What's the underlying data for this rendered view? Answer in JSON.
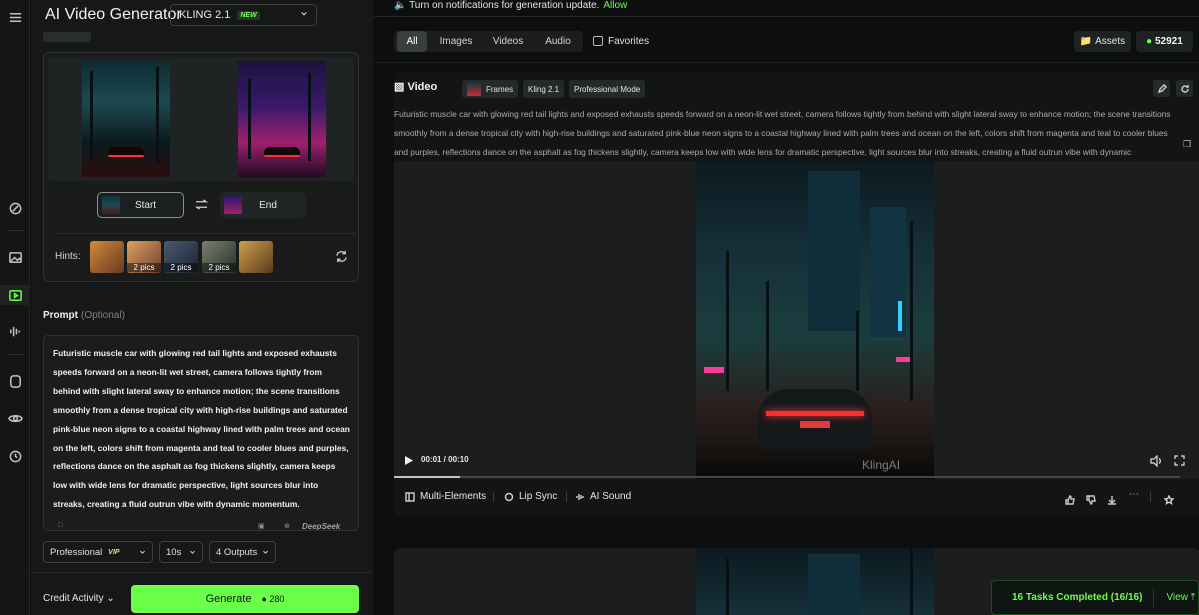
{
  "app": {
    "title": "AI Video Generator",
    "model": "KLING 2.1",
    "model_badge": "NEW"
  },
  "frames": {
    "start_label": "Start",
    "end_label": "End"
  },
  "hints": {
    "label": "Hints:",
    "items": [
      {
        "count": ""
      },
      {
        "count": "2 pics"
      },
      {
        "count": "2 pics"
      },
      {
        "count": "2 pics"
      },
      {
        "count": ""
      }
    ]
  },
  "prompt": {
    "label": "Prompt",
    "optional": "(Optional)",
    "text": "Futuristic muscle car with glowing red tail lights and exposed exhausts speeds forward on a neon-lit wet street, camera follows tightly from behind with slight lateral sway to enhance motion; the scene transitions smoothly from a dense tropical city with high-rise buildings and saturated pink-blue neon signs to a coastal highway lined with palm trees and ocean on the left, colors shift from magenta and teal to cooler blues and purples, reflections dance on the asphalt as fog thickens slightly, camera keeps low with wide lens for dramatic perspective, light sources blur into streaks, creating a fluid outrun vibe with dynamic momentum.",
    "assistant": "DeepSeek"
  },
  "settings": {
    "mode": "Professional",
    "mode_badge": "VIP",
    "duration": "10s",
    "outputs": "4 Outputs"
  },
  "footer": {
    "credit_activity": "Credit Activity",
    "generate": "Generate",
    "generate_cost": "280"
  },
  "notice": {
    "text": "Turn on notifications for generation update.",
    "allow": "Allow"
  },
  "filters": {
    "tabs": [
      "All",
      "Images",
      "Videos",
      "Audio"
    ],
    "active": "All",
    "favorites": "Favorites"
  },
  "account": {
    "assets": "Assets",
    "credits": "52921"
  },
  "result": {
    "heading": "Video",
    "chips": [
      "Frames",
      "Kling 2.1",
      "Professional Mode"
    ],
    "description": "Futuristic muscle car with glowing red tail lights and exposed exhausts speeds forward on a neon-lit wet street, camera follows tightly from behind with slight lateral sway to enhance motion; the scene transitions smoothly from a dense tropical city with high-rise buildings and saturated pink-blue neon signs to a coastal highway lined with palm trees and ocean on the left, colors shift from magenta and teal to cooler blues and purples, reflections dance on the asphalt as fog thickens slightly, camera keeps low with wide lens for dramatic perspective, light sources blur into streaks, creating a fluid outrun vibe with dynamic momentum.",
    "time": "00:01 / 00:10",
    "progress": 0.084,
    "watermark": "KlingAI",
    "actions": [
      "Multi-Elements",
      "Lip Sync",
      "AI Sound"
    ]
  },
  "toast": {
    "text": "16 Tasks Completed (16/16)",
    "view": "View"
  },
  "colors": {
    "accent": "#6bff4a",
    "background": "#0d0f0f",
    "panel": "#161818"
  }
}
